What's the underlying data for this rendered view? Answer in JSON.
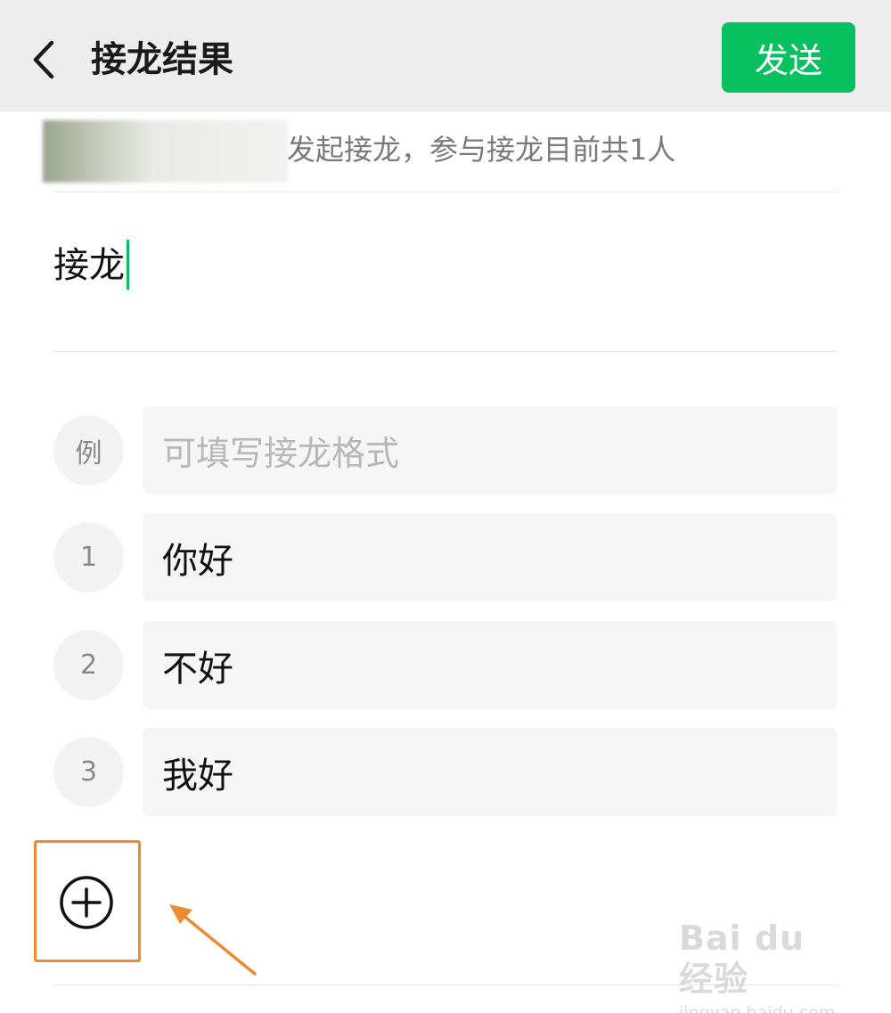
{
  "header": {
    "title": "接龙结果",
    "send_label": "发送",
    "accent": "#07c160"
  },
  "info": {
    "text": "发起接龙，参与接龙目前共1人"
  },
  "topic": {
    "value": "接龙"
  },
  "rows": [
    {
      "index": "例",
      "value": "",
      "placeholder": "可填写接龙格式"
    },
    {
      "index": "1",
      "value": "你好"
    },
    {
      "index": "2",
      "value": "不好"
    },
    {
      "index": "3",
      "value": "我好"
    }
  ],
  "annotation": {
    "highlight_color": "#ee8a2f"
  },
  "watermark": {
    "brand": "Bai du 经验",
    "url": "jingyan.baidu.com"
  },
  "icons": {
    "back": "chevron-left-icon",
    "add": "plus-circle-icon"
  }
}
